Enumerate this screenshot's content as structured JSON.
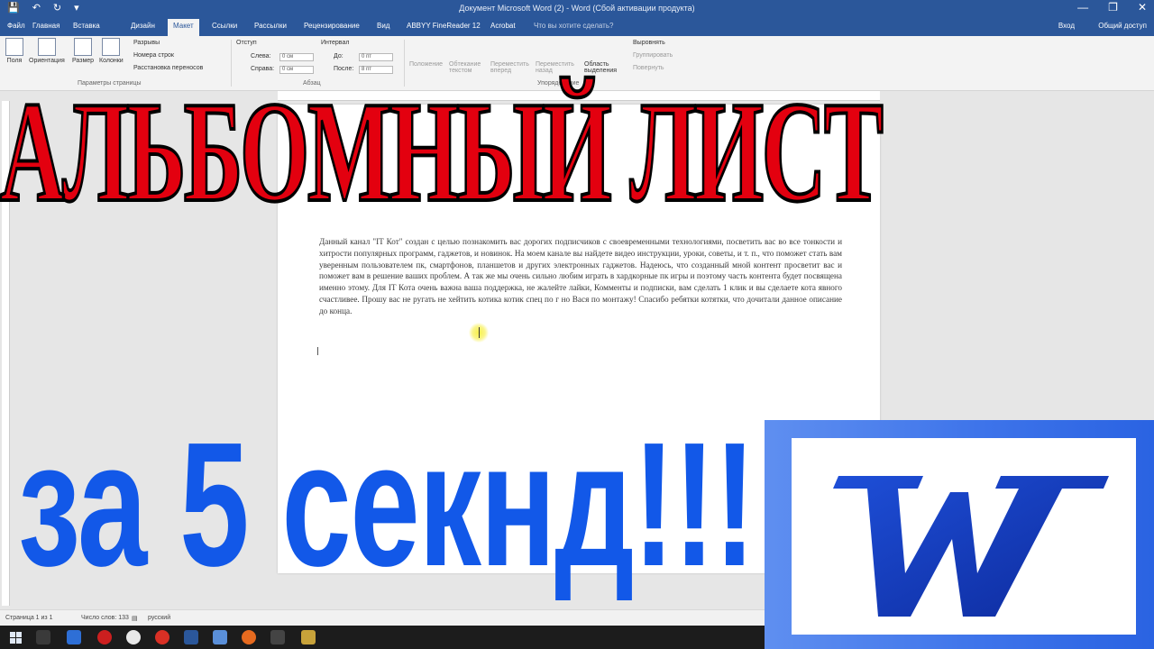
{
  "titlebar": {
    "title": "Документ Microsoft Word (2) - Word (Сбой активации продукта)",
    "quick_access": [
      "💾",
      "↶",
      "↻",
      "▾"
    ],
    "controls": [
      "—",
      "❐",
      "✕"
    ]
  },
  "tabs": {
    "items": [
      "Файл",
      "Главная",
      "Вставка",
      "Дизайн",
      "Макет",
      "Ссылки",
      "Рассылки",
      "Рецензирование",
      "Вид",
      "ABBYY FineReader 12",
      "Acrobat"
    ],
    "active": "Макет",
    "tell_me": "Что вы хотите сделать?",
    "sign_in": "Вход",
    "share": "Общий доступ"
  },
  "ribbon": {
    "page_setup": {
      "buttons": [
        "Поля",
        "Ориентация",
        "Размер",
        "Колонки"
      ],
      "breaks": "Разрывы",
      "line_numbers": "Номера строк",
      "hyphenation": "Расстановка переносов",
      "group": "Параметры страницы"
    },
    "indent": {
      "header": "Отступ",
      "left_label": "Слева:",
      "left_value": "0 см",
      "right_label": "Справа:",
      "right_value": "0 см"
    },
    "spacing": {
      "header": "Интервал",
      "before_label": "До:",
      "before_value": "0 пт",
      "after_label": "После:",
      "after_value": "8 пт"
    },
    "paragraph_group": "Абзац",
    "arrange": {
      "buttons": [
        "Положение",
        "Обтекание текстом",
        "Переместить вперед",
        "Переместить назад",
        "Область выделения"
      ],
      "align": "Выровнять",
      "group_btn": "Группировать",
      "rotate": "Повернуть",
      "group": "Упорядочение"
    }
  },
  "document": {
    "body_text": "Данный канал \"IT Кот\" создан с целью познакомить вас дорогих подписчиков с своевременными технологиями, посветить вас во все тонкости и хитрости популярных программ, гаджетов, и новинок. На моем канале вы найдете видео инструкции, уроки, советы, и т. п., что поможет стать вам уверенным пользователем пк, смартфонов, планшетов и других электронных гаджетов. Надеюсь, что созданный мной контент просветит вас и поможет вам в решение ваших проблем. А так же мы очень сильно любим играть в хардкорные пк игры и поэтому часть контента будет посвящена именно этому. Для IT Кота очень важна ваша поддержка, не жалейте лайки, Комменты и подписки, вам сделать 1 клик и вы сделаете кота явного счастливее. Прошу вас не ругать не хейтить котика котик спец по г но Вася по монтажу! Спасибо ребятки котятки, что дочитали данное описание до конца."
  },
  "statusbar": {
    "page": "Страница 1 из 1",
    "words": "Число слов: 133",
    "language": "русский"
  },
  "overlay": {
    "headline": "АЛЬБОМНЫЙ ЛИСТ",
    "subline": "за 5 секнд!!!",
    "logo_letter": "W"
  },
  "colors": {
    "word_blue": "#2b579a",
    "headline_red": "#e3000f",
    "subline_blue": "#1258e8",
    "logo_blue": "#3e74ea"
  }
}
